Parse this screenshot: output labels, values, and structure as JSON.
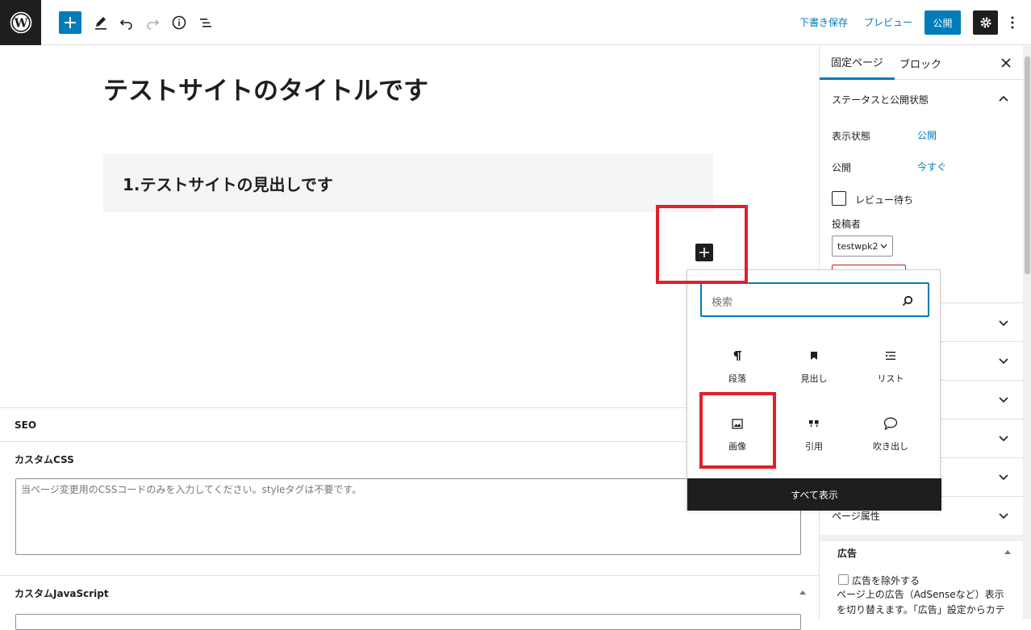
{
  "toolbar": {
    "save_draft": "下書き保存",
    "preview": "プレビュー",
    "publish": "公開"
  },
  "editor": {
    "title": "テストサイトのタイトルです",
    "heading_block": "1.テストサイトの見出しです"
  },
  "inserter": {
    "search_placeholder": "検索",
    "blocks": [
      {
        "label": "段落",
        "icon": "paragraph-icon"
      },
      {
        "label": "見出し",
        "icon": "bookmark-icon"
      },
      {
        "label": "リスト",
        "icon": "list-icon"
      },
      {
        "label": "画像",
        "icon": "image-icon"
      },
      {
        "label": "引用",
        "icon": "quote-icon"
      },
      {
        "label": "吹き出し",
        "icon": "speech-bubble-icon"
      }
    ],
    "show_all": "すべて表示"
  },
  "meta": {
    "seo_label": "SEO",
    "custom_css_label": "カスタムCSS",
    "custom_css_placeholder": "当ページ変更用のCSSコードのみを入力してください。styleタグは不要です。",
    "custom_js_label": "カスタムJavaScript"
  },
  "sidebar": {
    "tab_page": "固定ページ",
    "tab_block": "ブロック",
    "status_panel_title": "ステータスと公開状態",
    "visibility_label": "表示状態",
    "visibility_value": "公開",
    "publish_label": "公開",
    "publish_value": "今すぐ",
    "pending_review_label": "レビュー待ち",
    "author_label": "投稿者",
    "author_value": "testwpk2",
    "page_attributes_title": "ページ属性",
    "ads_title": "広告",
    "ads_exclude_label": "広告を除外する",
    "ads_description": "ページ上の広告（AdSenseなど）表示を切り替えます。「広告」設定からカテ"
  },
  "colors": {
    "accent": "#007cba",
    "dark": "#1e1e1e",
    "highlight": "#e0202a"
  }
}
